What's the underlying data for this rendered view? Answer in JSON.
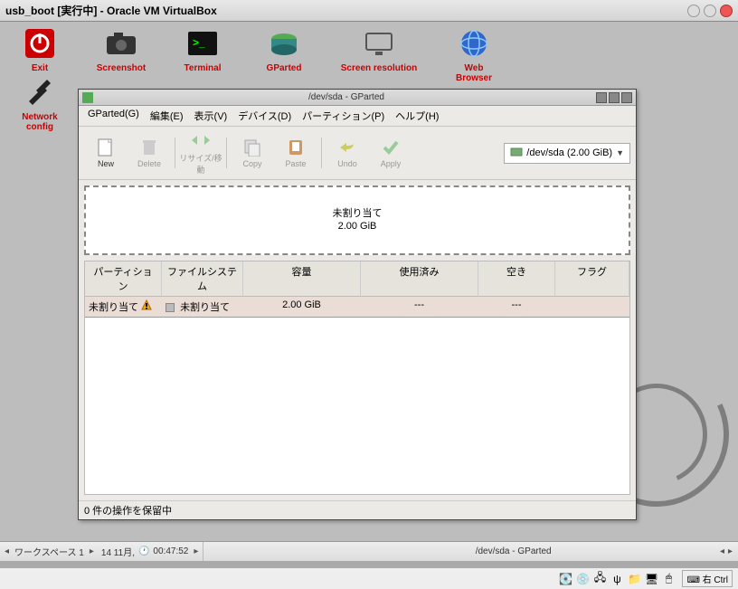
{
  "vbox": {
    "title": "usb_boot [実行中] - Oracle VM VirtualBox"
  },
  "desktop_icons": {
    "exit": "Exit",
    "screenshot": "Screenshot",
    "terminal": "Terminal",
    "gparted": "GParted",
    "resolution": "Screen resolution",
    "browser": "Web Browser",
    "netconfig": "Network config"
  },
  "gparted": {
    "title": "/dev/sda - GParted",
    "menu": {
      "gparted": "GParted(G)",
      "edit": "編集(E)",
      "view": "表示(V)",
      "device": "デバイス(D)",
      "partition": "パーティション(P)",
      "help": "ヘルプ(H)"
    },
    "toolbar": {
      "new": "New",
      "delete": "Delete",
      "resize": "リサイズ/移動",
      "copy": "Copy",
      "paste": "Paste",
      "undo": "Undo",
      "apply": "Apply"
    },
    "device_selector": "/dev/sda  (2.00 GiB)",
    "diskbar": {
      "line1": "未割り当て",
      "line2": "2.00 GiB"
    },
    "columns": {
      "partition": "パーティション",
      "filesystem": "ファイルシステム",
      "size": "容量",
      "used": "使用済み",
      "free": "空き",
      "flag": "フラグ"
    },
    "rows": [
      {
        "partition": "未割り当て",
        "fs": "未割り当て",
        "size": "2.00 GiB",
        "used": "---",
        "free": "---",
        "flag": ""
      }
    ],
    "status": "0 件の操作を保留中"
  },
  "taskbar": {
    "workspace": "ワークスペース 1",
    "date": "14 11月,",
    "time": "00:47:52",
    "app": "/dev/sda - GParted"
  },
  "hostbar": {
    "hostkey": "右 Ctrl"
  }
}
